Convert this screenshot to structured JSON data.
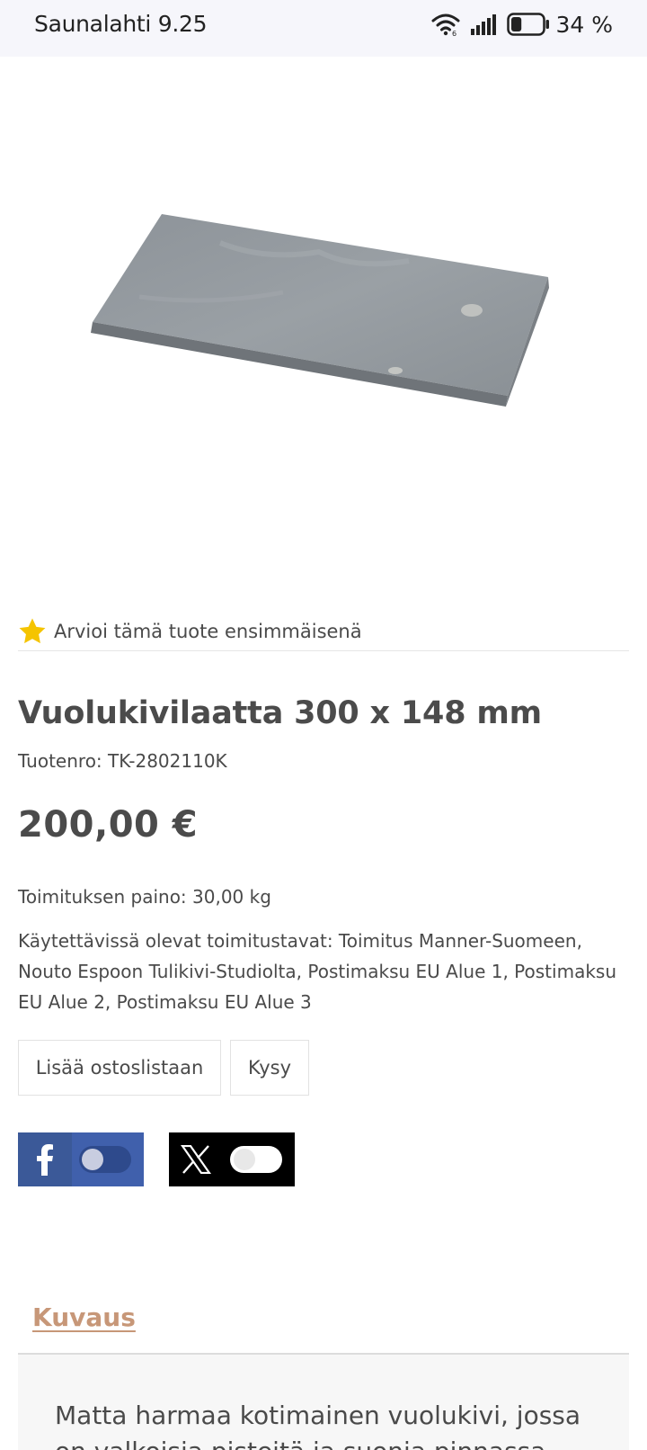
{
  "status_bar": {
    "carrier": "Saunalahti",
    "time": "9.25",
    "battery_percent": "34 %",
    "battery_level": 0.34,
    "icons": [
      "wifi-icon",
      "signal-icon",
      "battery-icon"
    ]
  },
  "product": {
    "image_icon": "stone-tile-image",
    "rating_icon": "star-icon",
    "rating_prompt": "Arvioi tämä tuote ensimmäisenä",
    "title": "Vuolukivilaatta 300 x 148 mm",
    "sku": "Tuotenro: TK-2802110K",
    "price": "200,00 €",
    "shipping_weight": "Toimituksen paino: 30,00 kg",
    "delivery_methods": "Käytettävissä olevat toimitustavat: Toimitus Manner-Suomeen, Nouto Espoon Tulikivi-Studiolta, Postimaksu EU Alue 1, Postimaksu EU Alue 2, Postimaksu EU Alue 3"
  },
  "actions": {
    "add_to_list": "Lisää ostoslistaan",
    "ask": "Kysy"
  },
  "share": {
    "facebook_icon": "facebook-icon",
    "x_icon": "x-icon",
    "facebook_enabled": false,
    "x_enabled": false
  },
  "tabs": {
    "description_label": "Kuvaus"
  },
  "description": {
    "text": "Matta harmaa kotimainen vuolukivi, jossa on valkoisia pisteitä ja suonia pinnassa."
  },
  "colors": {
    "accent_tab": "#c79778",
    "facebook_blue": "#3b5998",
    "star": "#f5c400"
  }
}
